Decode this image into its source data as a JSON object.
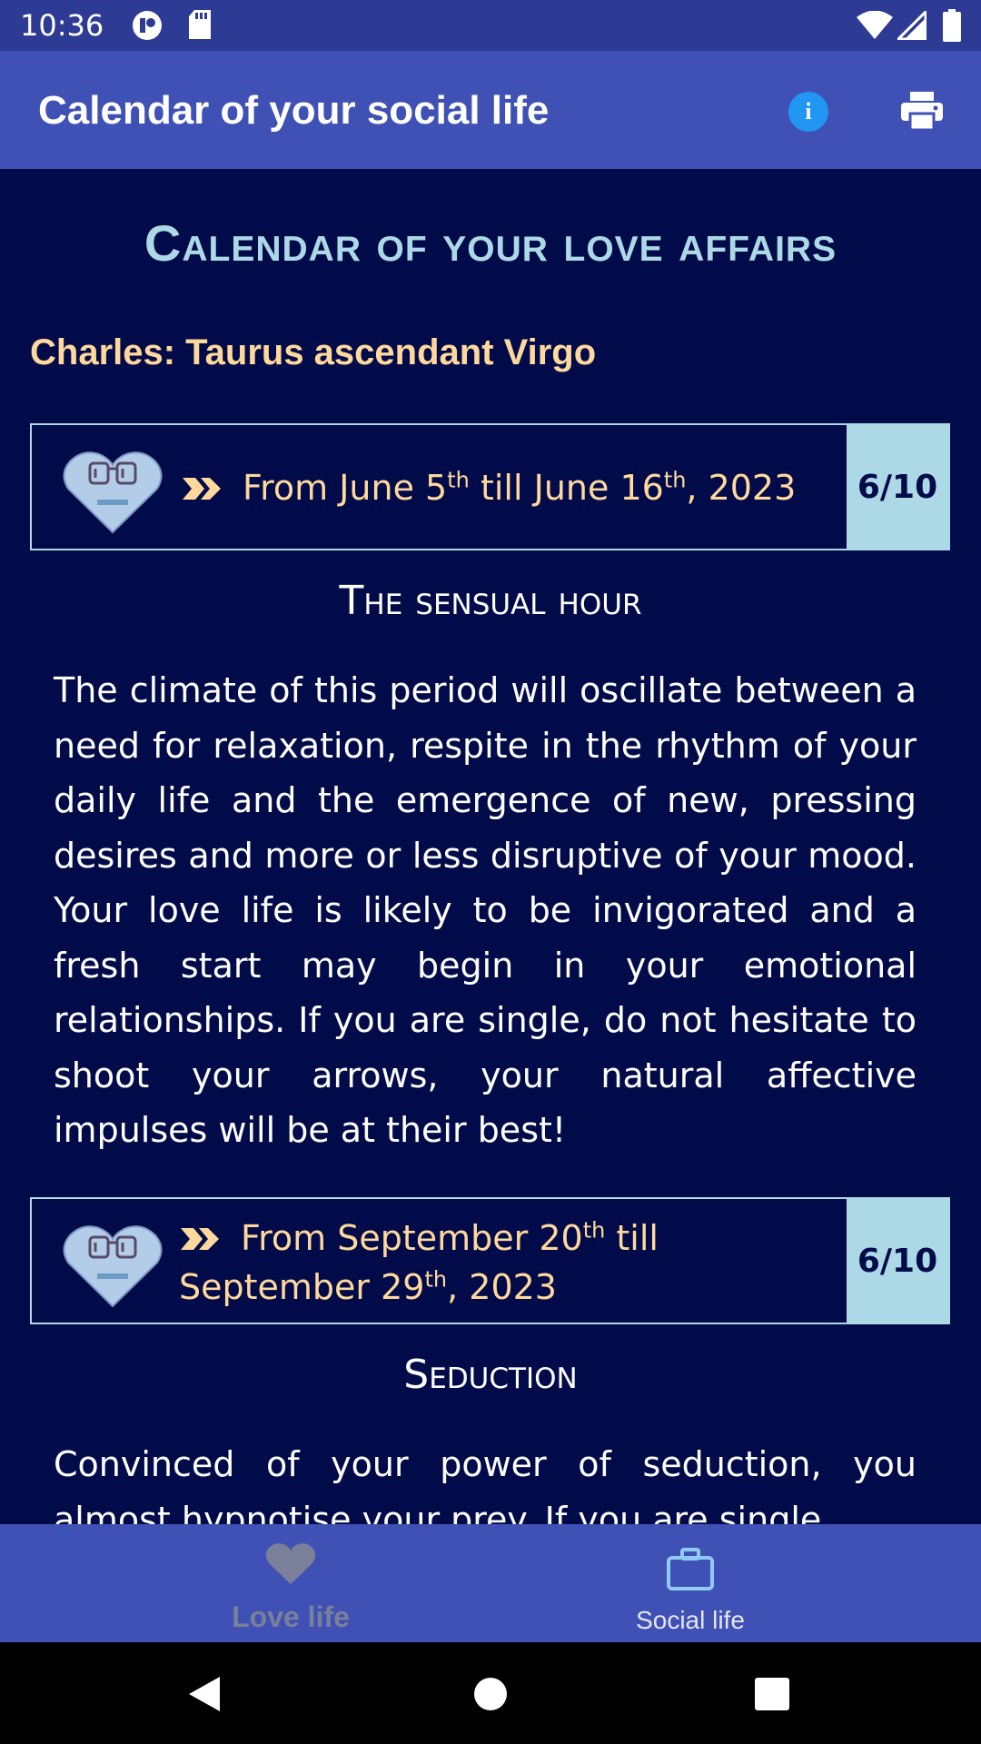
{
  "status_bar": {
    "time": "10:36",
    "icons": [
      "app-notification-icon",
      "sd-card-icon",
      "wifi-icon",
      "cellular-signal-icon",
      "battery-icon"
    ]
  },
  "app_bar": {
    "title": "Calendar of your social life",
    "info_label": "i",
    "icons": [
      "info-icon",
      "print-icon"
    ]
  },
  "content": {
    "page_title": "Calendar of your love affairs",
    "subject": "Charles: Taurus ascendant Virgo",
    "periods": [
      {
        "prefix": "From June 5",
        "sup1": "th",
        "middle": " till June 16",
        "sup2": "th",
        "suffix": ", 2023",
        "rating": "6/10",
        "heading": "The sensual hour",
        "body": "The climate of this period will oscillate between a need for relaxation, respite in the rhythm of your daily life and the emergence of new, pressing desires and more or less disruptive of your mood. Your love life is likely to be invigorated and a fresh start may begin in your emotional relationships. If you are single, do not hesitate to shoot your arrows, your natural affective impulses will be at their best!"
      },
      {
        "prefix": "From September 20",
        "sup1": "th",
        "middle": " till September 29",
        "sup2": "th",
        "suffix": ", 2023",
        "rating": "6/10",
        "heading": "Seduction",
        "body": "Convinced of your power of seduction, you almost hypnotise your prey. If you are single,"
      }
    ]
  },
  "bottom_nav": {
    "items": [
      {
        "label": "Love life",
        "icon": "heart-icon",
        "selected": true
      },
      {
        "label": "Social life",
        "icon": "briefcase-icon",
        "selected": false
      }
    ]
  },
  "colors": {
    "background": "#020b4a",
    "app_bar": "#3f51b5",
    "status_bar": "#2e3b94",
    "accent_gold": "#ffd89b",
    "accent_light_blue": "#add8e6"
  }
}
